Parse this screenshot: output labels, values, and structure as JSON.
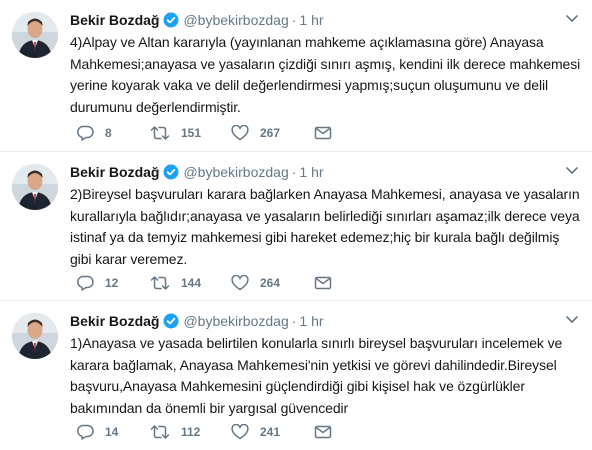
{
  "colors": {
    "verified": "#1da1f2",
    "secondary_text": "#657786",
    "divider": "#e6ecf0"
  },
  "icons": {
    "reply": "reply-icon",
    "retweet": "retweet-icon",
    "like": "heart-icon",
    "dm": "envelope-icon",
    "verified": "verified-badge-icon",
    "more": "chevron-down-icon"
  },
  "tweets": [
    {
      "name": "Bekir Bozdağ",
      "handle": "@bybekirbozdag",
      "separator": "·",
      "time": "1 hr",
      "lines": [
        "4)Alpay ve Altan kararıyla (yayınlanan mahkeme açıklamasına göre) Anayasa",
        "Mahkemesi;anayasa ve yasaların çizdiği sınırı aşmış, kendini ilk derece mahkemesi",
        "yerine koyarak vaka ve delil değerlendirmesi yapmış;suçun oluşumunu ve delil",
        "durumunu değerlendirmiştir."
      ],
      "replies": "8",
      "retweets": "151",
      "likes": "267"
    },
    {
      "name": "Bekir Bozdağ",
      "handle": "@bybekirbozdag",
      "separator": "·",
      "time": "1 hr",
      "lines": [
        "2)Bireysel başvuruları karara bağlarken Anayasa Mahkemesi, anayasa ve yasaların",
        "kurallarıyla bağlıdır;anayasa ve yasaların belirlediği sınırları aşamaz;ilk derece veya",
        "istinaf ya da temyiz mahkemesi gibi hareket edemez;hiç bir kurala bağlı değilmiş",
        "gibi karar veremez."
      ],
      "replies": "12",
      "retweets": "144",
      "likes": "264"
    },
    {
      "name": "Bekir Bozdağ",
      "handle": "@bybekirbozdag",
      "separator": "·",
      "time": "1 hr",
      "lines": [
        "1)Anayasa ve yasada belirtilen konularla sınırlı bireysel başvuruları incelemek ve",
        "karara bağlamak, Anayasa Mahkemesi'nin yetkisi ve görevi dahilindedir.Bireysel",
        "başvuru,Anayasa Mahkemesini güçlendirdiği gibi kişisel hak ve özgürlükler",
        "bakımından da önemli bir yargısal güvencedir"
      ],
      "replies": "14",
      "retweets": "112",
      "likes": "241"
    }
  ]
}
